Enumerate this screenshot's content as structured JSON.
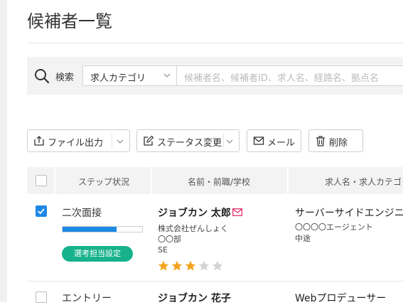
{
  "page": {
    "title": "候補者一覧"
  },
  "search": {
    "label": "検索",
    "category_value": "求人カテゴリ",
    "keyword_placeholder": "候補者名、候補者ID、求人名、経路名、拠点名"
  },
  "toolbar": {
    "export_label": "ファイル出力",
    "status_label": "ステータス変更",
    "mail_label": "メール",
    "delete_label": "削除"
  },
  "table": {
    "headers": {
      "step": "ステップ状況",
      "name": "名前・前職/学校",
      "job": "求人名・求人カテゴリ"
    },
    "rows": [
      {
        "checked": true,
        "step": "二次面接",
        "progress": 0.68,
        "action_label": "選考担当設定",
        "name": "ジョブカン 太郎",
        "company": "株式会社ぜんしょく",
        "department": "〇〇部",
        "position": "SE",
        "rating": 3,
        "rating_max": 5,
        "job": "サーバーサイドエンジニア",
        "agent": "〇〇〇〇エージェント",
        "hire_type": "中途"
      },
      {
        "checked": false,
        "step": "エントリー",
        "name": "ジョブカン 花子",
        "job": "Webプロデューサー"
      }
    ]
  },
  "colors": {
    "accent": "#1e88e5",
    "action": "#17b28c",
    "star_on": "#f4a31f",
    "star_off": "#d3d3d3",
    "mail": "#e2336b"
  }
}
